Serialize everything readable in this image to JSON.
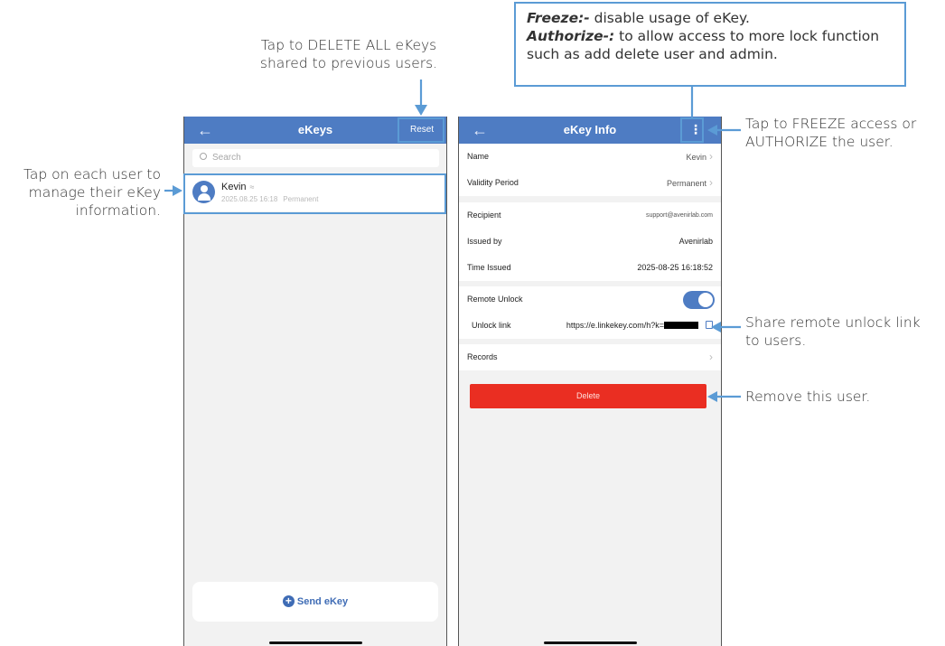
{
  "annotations": {
    "reset": [
      "Tap to DELETE ALL eKeys",
      "shared to previous users."
    ],
    "user": [
      "Tap on each user to",
      "manage their eKey",
      "information."
    ],
    "menu": [
      "Tap to FREEZE access or",
      "AUTHORIZE the user."
    ],
    "link": [
      "Share remote unlock link",
      "to users."
    ],
    "delete": [
      "Remove this user."
    ],
    "callout": {
      "freeze_term": "Freeze:-",
      "freeze_text": " disable usage of eKey.",
      "authorize_term": "Authorize-:",
      "authorize_text": " to allow access to more lock function",
      "line3": "such as add delete user and admin."
    }
  },
  "left_screen": {
    "back_icon": "arrow-left-icon",
    "title": "eKeys",
    "reset_label": "Reset",
    "search_placeholder": "Search",
    "users": [
      {
        "name": "Kevin",
        "date": "2025.08.25 16:18",
        "validity": "Permanent"
      }
    ],
    "send_label": "Send eKey"
  },
  "right_screen": {
    "back_icon": "arrow-left-icon",
    "title": "eKey Info",
    "menu_icon": "more-vertical-icon",
    "name_label": "Name",
    "name_value": "Kevin",
    "validity_label": "Validity Period",
    "validity_value": "Permanent",
    "recipient_label": "Recipient",
    "recipient_value": "support@avenirlab.com",
    "issued_by_label": "Issued by",
    "issued_by_value": "Avenirlab",
    "time_issued_label": "Time Issued",
    "time_issued_value": "2025-08-25 16:18:52",
    "remote_unlock_label": "Remote Unlock",
    "remote_unlock_on": true,
    "unlock_link_label": "Unlock link",
    "unlock_link_value": "https://e.linkekey.com/h?k=",
    "records_label": "Records",
    "delete_label": "Delete"
  },
  "colors": {
    "primary": "#4e7cc3",
    "danger": "#ea2e22",
    "annotation": "#5b9bd5"
  }
}
